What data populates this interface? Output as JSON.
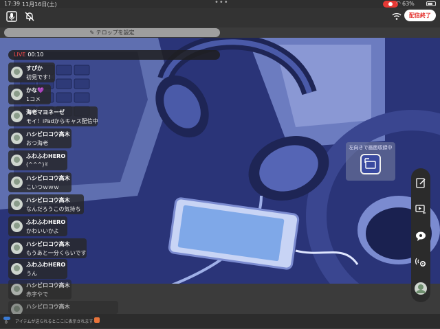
{
  "status": {
    "time": "17:39",
    "date": "11月16日(土)",
    "battery": "63%"
  },
  "toolbar": {
    "end_label": "配信終了",
    "telop_label": "テロップを設定"
  },
  "live": {
    "tag": "LIVE",
    "elapsed": "00:10"
  },
  "comments": [
    {
      "name": "すぴか",
      "text": "初見です！"
    },
    {
      "name": "かな💜",
      "text": "1コメ"
    },
    {
      "name": "海老マヨネーゼ",
      "text": "モイ！iPadからキャス配信中"
    },
    {
      "name": "ハシビロコウ高木",
      "text": "おつ海老"
    },
    {
      "name": "ふわふわHERO",
      "text": "(^^^)✌"
    },
    {
      "name": "ハシビロコウ高木",
      "text": "こいつｗｗｗ"
    },
    {
      "name": "ハシビロコウ高木",
      "text": "なんだろうこの気持ち"
    },
    {
      "name": "ふわふわHERO",
      "text": "かわいいかよ"
    },
    {
      "name": "ハシビロコウ高木",
      "text": "もうあと一分くらいです"
    },
    {
      "name": "ふわふわHERO",
      "text": "うん"
    },
    {
      "name": "ハシビロコウ高木",
      "text": "赤字やで"
    },
    {
      "name": "ハシビロコウ高木",
      "text": ""
    }
  ],
  "landscape": {
    "label": "左向きで画面収録中"
  },
  "bottom": {
    "count": "0",
    "item_message": "アイテムが送られるとここに表示されます"
  },
  "colors": {
    "accent_red": "#e53935",
    "stage_blue": "#2a3478"
  }
}
